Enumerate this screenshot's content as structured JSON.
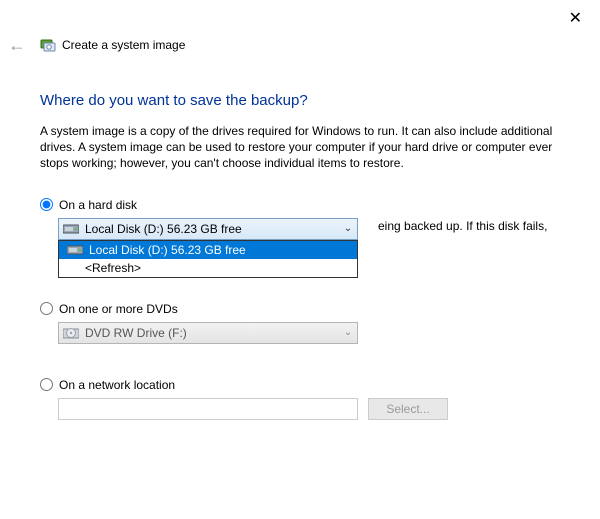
{
  "window": {
    "title": "Create a system image"
  },
  "heading": "Where do you want to save the backup?",
  "description": "A system image is a copy of the drives required for Windows to run. It can also include additional drives. A system image can be used to restore your computer if your hard drive or computer ever stops working; however, you can't choose individual items to restore.",
  "options": {
    "hard_disk": {
      "label": "On a hard disk",
      "selected_text": "Local Disk (D:)  56.23 GB free",
      "dropdown": {
        "item_selected": "Local Disk (D:)  56.23 GB free",
        "item_refresh": "<Refresh>"
      },
      "warning_fragment": "eing backed up. If this disk fails,"
    },
    "dvd": {
      "label": "On one or more DVDs",
      "selected_text": "DVD RW Drive (F:)"
    },
    "network": {
      "label": "On a network location",
      "select_button": "Select..."
    }
  }
}
